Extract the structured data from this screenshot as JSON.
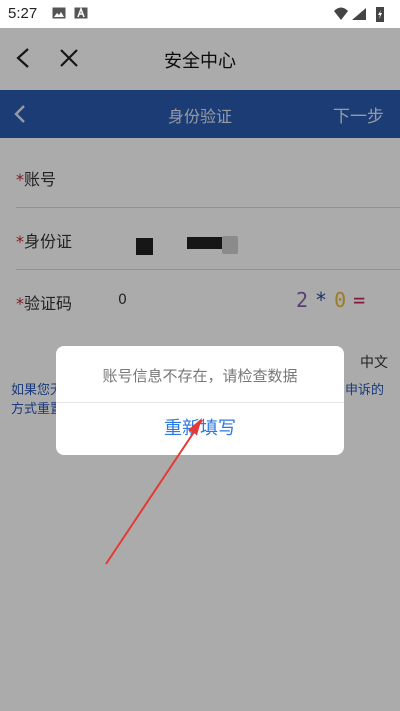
{
  "status_bar": {
    "time": "5:27"
  },
  "app_bar": {
    "title": "安全中心"
  },
  "sub_header": {
    "title": "身份验证",
    "next_label": "下一步"
  },
  "form": {
    "required_mark": "*",
    "rows": [
      {
        "label": "账号",
        "value": ""
      },
      {
        "label": "身份证",
        "value": ""
      },
      {
        "label": "验证码",
        "value": "0"
      }
    ],
    "captcha": {
      "chars": [
        "2",
        "*",
        "0",
        "="
      ],
      "colors": [
        "#8a5fa8",
        "#2c4a9a",
        "#e8b93a",
        "#c0275a"
      ]
    }
  },
  "footer": {
    "language": "中文",
    "help_line1": "如果您无",
    "help_line2": "方式重置",
    "help_right": "申诉的"
  },
  "dialog": {
    "message": "账号信息不存在，请检查数据",
    "button_label": "重新填写"
  },
  "colors": {
    "header_blue": "#2a5ab0",
    "link_blue": "#2b7ae0",
    "required_red": "#c0272d",
    "arrow_red": "#e53935"
  }
}
